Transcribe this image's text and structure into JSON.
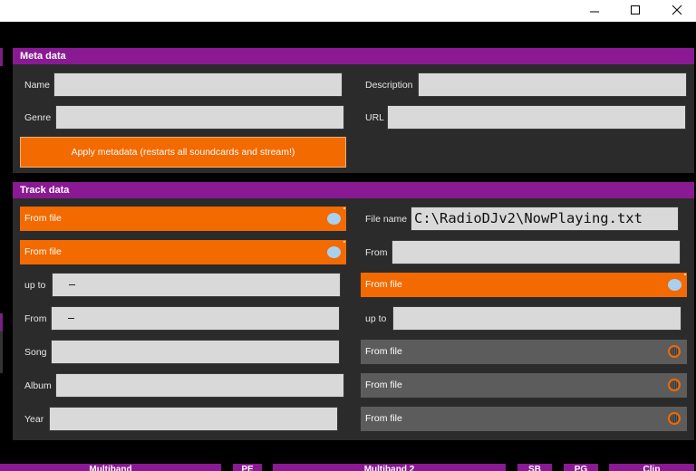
{
  "window": {
    "minimize_icon": "minimize-icon",
    "maximize_icon": "maximize-icon",
    "close_icon": "close-icon"
  },
  "meta_panel": {
    "title": "Meta data",
    "name_label": "Name",
    "name_value": "",
    "description_label": "Description",
    "description_value": "",
    "genre_label": "Genre",
    "genre_value": "",
    "url_label": "URL",
    "url_value": "",
    "apply_label": "Apply metadata (restarts all soundcards and stream!)"
  },
  "track_panel": {
    "title": "Track data",
    "source_a_label": "From file",
    "source_b_label": "From file",
    "file_name_label": "File name",
    "file_name_value": "C:\\RadioDJv2\\NowPlaying.txt",
    "from_right_label": "From",
    "from_right_value": "",
    "upto_label": "up to",
    "upto_value": "–",
    "source_c_label": "From file",
    "from_left_label": "From",
    "from_left_value": "–",
    "upto_right_label": "up to",
    "upto_right_value": "",
    "song_label": "Song",
    "song_value": "",
    "source_d_label": "From file",
    "album_label": "Album",
    "album_value": "",
    "source_e_label": "From file",
    "year_label": "Year",
    "year_value": "",
    "source_f_label": "From file"
  },
  "bottom_tabs": [
    "Multiband",
    "PE",
    "Multiband 2",
    "SB",
    "PG",
    "Clip"
  ],
  "colors": {
    "accent": "#f26a00",
    "header": "#8a1a93",
    "panel": "#2b2b2b",
    "inactive": "#5c5c5c",
    "toggle_on": "#a8d0f0"
  }
}
